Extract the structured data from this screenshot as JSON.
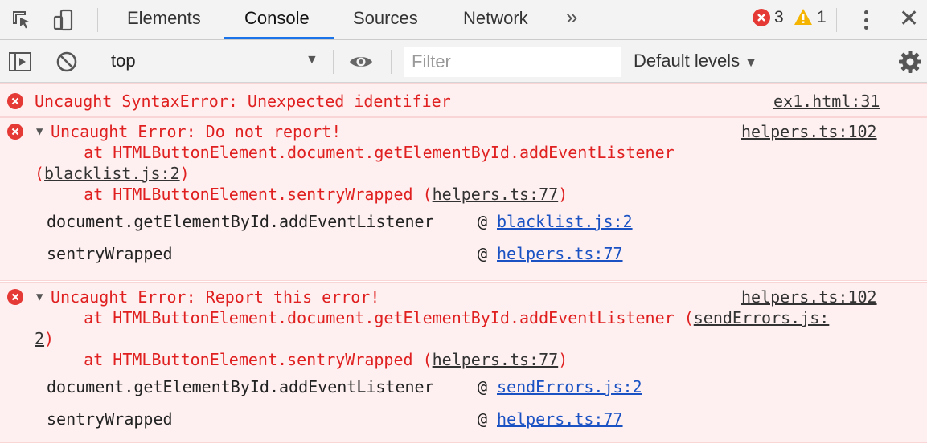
{
  "tabs": {
    "items": [
      {
        "label": "Elements"
      },
      {
        "label": "Console"
      },
      {
        "label": "Sources"
      },
      {
        "label": "Network"
      }
    ],
    "more": "»",
    "error_count": "3",
    "warning_count": "1"
  },
  "toolbar": {
    "context": "top",
    "filter_placeholder": "Filter",
    "levels": "Default levels"
  },
  "messages": [
    {
      "text": "Uncaught SyntaxError: Unexpected identifier",
      "source": "ex1.html:31"
    },
    {
      "text": "Uncaught Error: Do not report!",
      "source": "helpers.ts:102",
      "stack_line1": "    at HTMLButtonElement.document.getElementById.addEventListener",
      "stack_line1_link": "blacklist.js:2",
      "stack_line2": "    at HTMLButtonElement.sentryWrapped (",
      "stack_line2_link": "helpers.ts:77",
      "trace": [
        {
          "fn": "document.getElementById.addEventListener",
          "at": "@",
          "link": "blacklist.js:2"
        },
        {
          "fn": "sentryWrapped",
          "at": "@",
          "link": "helpers.ts:77"
        }
      ]
    },
    {
      "text": "Uncaught Error: Report this error!",
      "source": "helpers.ts:102",
      "stack_line1": "    at HTMLButtonElement.document.getElementById.addEventListener (",
      "stack_line1_link_a": "sendErrors.js:",
      "stack_line1_link_b": "2",
      "stack_line2": "    at HTMLButtonElement.sentryWrapped (",
      "stack_line2_link": "helpers.ts:77",
      "trace": [
        {
          "fn": "document.getElementById.addEventListener",
          "at": "@",
          "link": "sendErrors.js:2"
        },
        {
          "fn": "sentryWrapped",
          "at": "@",
          "link": "helpers.ts:77"
        }
      ]
    }
  ],
  "colors": {
    "accent": "#1a73e8",
    "error": "#e02020",
    "error_bg": "#fef0f0",
    "link": "#1a52c4"
  }
}
